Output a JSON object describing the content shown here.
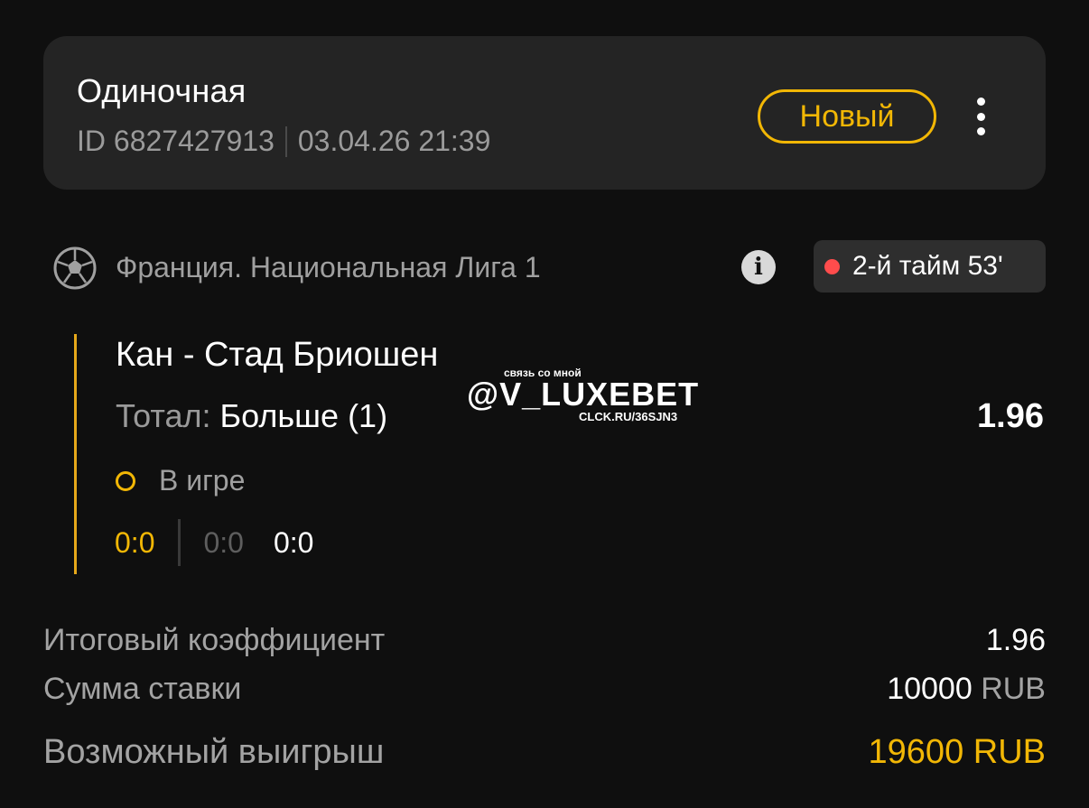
{
  "header": {
    "bet_type": "Одиночная",
    "bet_id": "ID 6827427913",
    "datetime": "03.04.26 21:39",
    "status": "Новый",
    "more_icon": "more-vertical-icon"
  },
  "league": {
    "sport_icon": "soccer-ball-icon",
    "name": "Франция. Национальная Лига 1",
    "info_icon": "info-icon",
    "live_status": "2-й тайм 53'"
  },
  "event": {
    "name": "Кан - Стад Бриошен",
    "market_label": "Тотал:",
    "outcome": "Больше (1)",
    "odds": "1.96",
    "state": "В игре",
    "score_main": "0:0",
    "score_second": "0:0",
    "score_third": "0:0"
  },
  "watermark": {
    "top": "связь со мной",
    "main": "@V_LUXEBET",
    "link": "CLCK.RU/36SJN3"
  },
  "summary": {
    "total_odds_label": "Итоговый коэффициент",
    "total_odds_value": "1.96",
    "stake_label": "Сумма ставки",
    "stake_amount": "10000",
    "stake_currency": "RUB",
    "win_label": "Возможный выигрыш",
    "win_value": "19600 RUB"
  },
  "colors": {
    "accent": "#f2b705",
    "background": "#0f0f0f",
    "card": "#242424",
    "live_dot": "#ff4c4c"
  }
}
